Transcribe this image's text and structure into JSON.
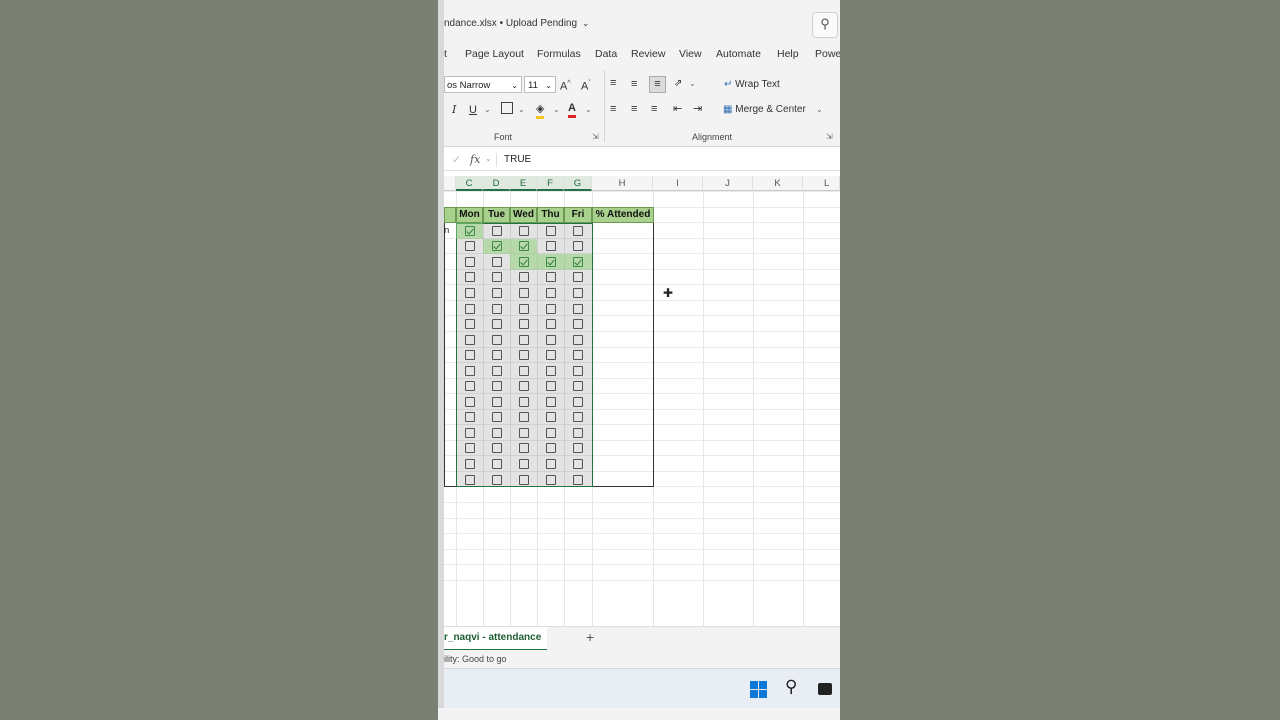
{
  "title": {
    "filename": "ndance.xlsx",
    "separator": "•",
    "status": "Upload Pending"
  },
  "ribbon_tabs": [
    "t",
    "Page Layout",
    "Formulas",
    "Data",
    "Review",
    "View",
    "Automate",
    "Help",
    "Powe"
  ],
  "font": {
    "name": "os Narrow",
    "size": "11",
    "group_label": "Font"
  },
  "alignment": {
    "wrap_text": "Wrap Text",
    "merge_center": "Merge & Center",
    "group_label": "Alignment"
  },
  "formula_bar": {
    "value": "TRUE"
  },
  "columns": [
    "C",
    "D",
    "E",
    "F",
    "G",
    "H",
    "I",
    "J",
    "K",
    "L"
  ],
  "table": {
    "headers": [
      "Mon",
      "Tue",
      "Wed",
      "Thu",
      "Fri",
      "% Attended"
    ],
    "first_row_label_fragment": "n",
    "checked": [
      [
        true,
        false,
        false,
        false,
        false
      ],
      [
        false,
        true,
        true,
        false,
        false
      ],
      [
        false,
        false,
        true,
        true,
        true
      ],
      [
        false,
        false,
        false,
        false,
        false
      ],
      [
        false,
        false,
        false,
        false,
        false
      ],
      [
        false,
        false,
        false,
        false,
        false
      ],
      [
        false,
        false,
        false,
        false,
        false
      ],
      [
        false,
        false,
        false,
        false,
        false
      ],
      [
        false,
        false,
        false,
        false,
        false
      ],
      [
        false,
        false,
        false,
        false,
        false
      ],
      [
        false,
        false,
        false,
        false,
        false
      ],
      [
        false,
        false,
        false,
        false,
        false
      ],
      [
        false,
        false,
        false,
        false,
        false
      ],
      [
        false,
        false,
        false,
        false,
        false
      ],
      [
        false,
        false,
        false,
        false,
        false
      ],
      [
        false,
        false,
        false,
        false,
        false
      ],
      [
        false,
        false,
        false,
        false,
        false
      ]
    ]
  },
  "sheet_tab": {
    "label": "r_naqvi - attendance",
    "add": "+"
  },
  "status_bar": {
    "text": "ility: Good to go"
  },
  "colors": {
    "accent": "#217346",
    "header_fill": "#a9d18e",
    "highlight": "#92d07c"
  }
}
